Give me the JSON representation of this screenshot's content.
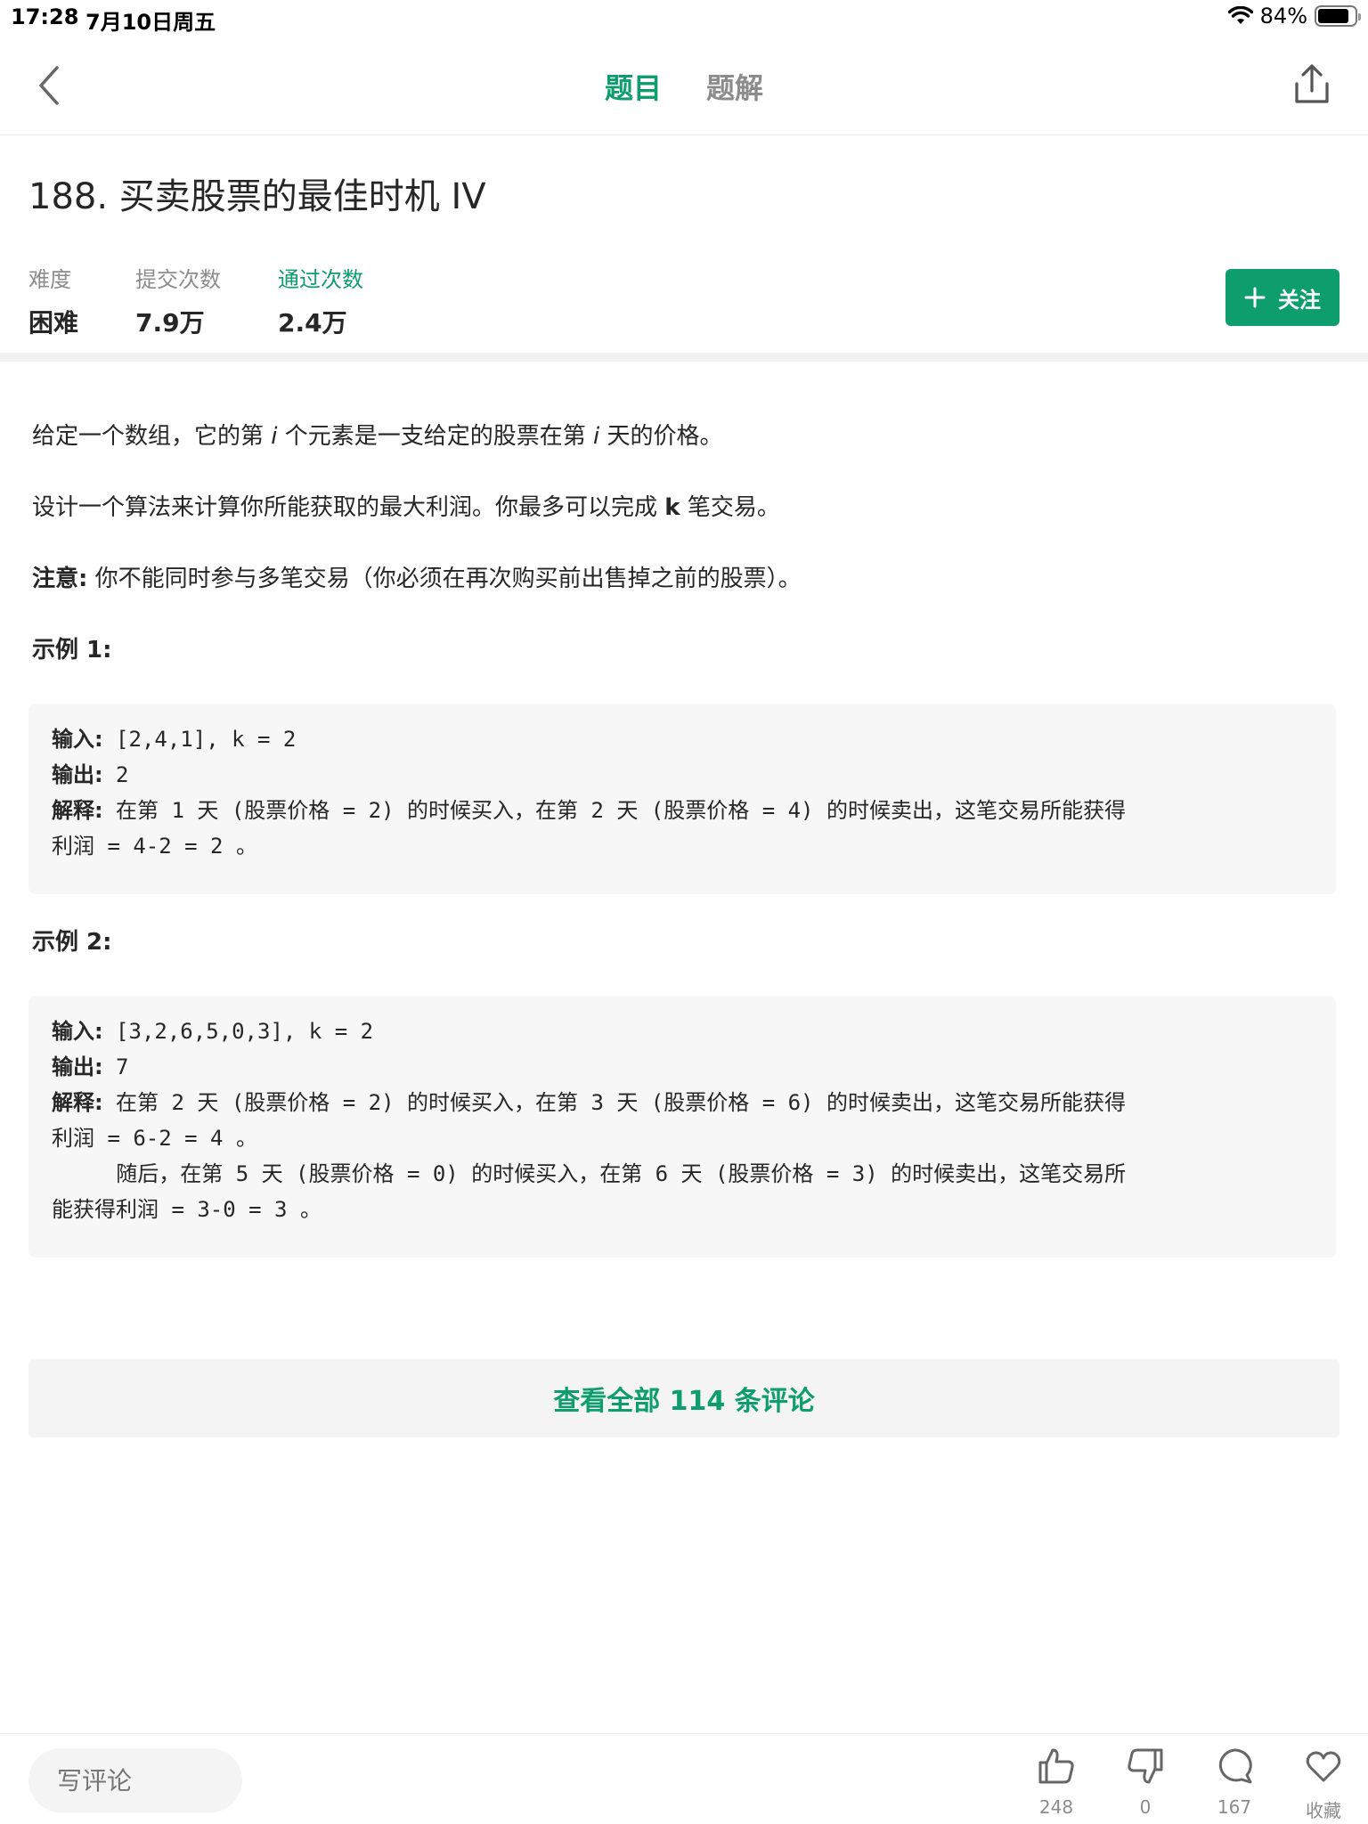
{
  "status": {
    "time": "17:28",
    "date": "7月10日周五",
    "battery": "84%",
    "battery_level": 0.84
  },
  "nav": {
    "tabs": [
      {
        "label": "题目"
      },
      {
        "label": "题解"
      }
    ]
  },
  "problem": {
    "title": "188. 买卖股票的最佳时机 IV",
    "stats": [
      {
        "label": "难度",
        "value": "困难"
      },
      {
        "label": "提交次数",
        "value": "7.9万"
      },
      {
        "label": "通过次数",
        "value": "2.4万"
      }
    ],
    "follow_label": "关注"
  },
  "content": {
    "p1_a": "给定一个数组，它的第 ",
    "p1_i1": "i",
    "p1_b": " 个元素是一支给定的股票在第 ",
    "p1_i2": "i",
    "p1_c": " 天的价格。",
    "p2_a": "设计一个算法来计算你所能获取的最大利润。你最多可以完成 ",
    "p2_k": "k",
    "p2_b": " 笔交易。",
    "note_label": "注意:",
    "note_text": " 你不能同时参与多笔交易（你必须在再次购买前出售掉之前的股票）。",
    "example1_heading": "示例 1:",
    "example1": {
      "input_label": "输入:",
      "input_value": " [2,4,1], k = 2",
      "output_label": "输出:",
      "output_value": " 2",
      "explain_label": "解释:",
      "explain_line1": " 在第 1 天 (股票价格 = 2) 的时候买入，在第 2 天 (股票价格 = 4) 的时候卖出，这笔交易所能获得",
      "explain_line2": "利润 = 4-2 = 2 。"
    },
    "example2_heading": "示例 2:",
    "example2": {
      "input_label": "输入:",
      "input_value": " [3,2,6,5,0,3], k = 2",
      "output_label": "输出:",
      "output_value": " 7",
      "explain_label": "解释:",
      "explain_line1": " 在第 2 天 (股票价格 = 2) 的时候买入，在第 3 天 (股票价格 = 6) 的时候卖出，这笔交易所能获得",
      "explain_line2": "利润 = 6-2 = 4 。",
      "explain_line3": "     随后，在第 5 天 (股票价格 = 0) 的时候买入，在第 6 天 (股票价格 = 3) 的时候卖出，这笔交易所",
      "explain_line4": "能获得利润 = 3-0 = 3 。"
    }
  },
  "comments_button": "查看全部 114 条评论",
  "bottom": {
    "comment_placeholder": "写评论",
    "like_count": "248",
    "dislike_count": "0",
    "comment_count": "167",
    "favorite_label": "收藏"
  },
  "colors": {
    "accent": "#0e9e6e",
    "muted": "#8c8c8c",
    "panel": "#f7f7f7"
  }
}
